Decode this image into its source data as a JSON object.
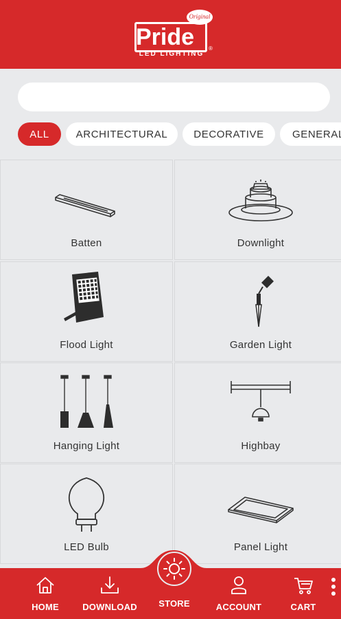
{
  "brand": {
    "name": "Pride",
    "badge": "Original",
    "tagline": "LED LIGHTING",
    "reg_mark": "®",
    "color": "#d6292a"
  },
  "search": {
    "placeholder": "",
    "value": ""
  },
  "categories": [
    {
      "label": "ALL",
      "active": true
    },
    {
      "label": "ARCHITECTURAL",
      "active": false
    },
    {
      "label": "DECORATIVE",
      "active": false
    },
    {
      "label": "GENERAL",
      "active": false
    }
  ],
  "products": [
    {
      "label": "Batten",
      "icon": "batten-icon"
    },
    {
      "label": "Downlight",
      "icon": "downlight-icon"
    },
    {
      "label": "Flood Light",
      "icon": "flood-light-icon"
    },
    {
      "label": "Garden Light",
      "icon": "garden-light-icon"
    },
    {
      "label": "Hanging Light",
      "icon": "hanging-light-icon"
    },
    {
      "label": "Highbay",
      "icon": "highbay-icon"
    },
    {
      "label": "LED Bulb",
      "icon": "led-bulb-icon"
    },
    {
      "label": "Panel Light",
      "icon": "panel-light-icon"
    }
  ],
  "nav": {
    "home": "HOME",
    "download": "DOWNLOAD",
    "store": "STORE",
    "account": "ACCOUNT",
    "cart": "CART"
  }
}
